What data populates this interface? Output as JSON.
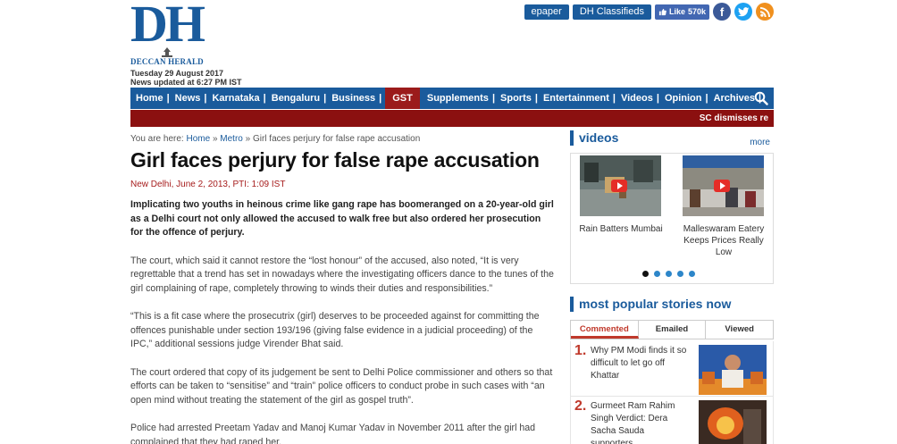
{
  "header": {
    "logo_text": "DH",
    "logo_sub": "DECCAN HERALD",
    "date": "Tuesday 29 August 2017",
    "updated": "News updated at 6:27 PM IST",
    "buttons": [
      "epaper",
      "DH Classifieds"
    ],
    "like_label": "Like",
    "like_count": "570k"
  },
  "nav": {
    "items": [
      "Home",
      "News",
      "Karnataka",
      "Bengaluru",
      "Business",
      "GST",
      "Supplements",
      "Sports",
      "Entertainment",
      "Videos",
      "Opinion",
      "Archives"
    ],
    "ticker": "SC dismisses re"
  },
  "article": {
    "crumb_prefix": "You are here:",
    "crumbs": [
      "Home",
      "Metro",
      "Girl faces perjury for false rape accusation"
    ],
    "crumb_sep": "»",
    "headline": "Girl faces perjury for false rape accusation",
    "dateline": "New Delhi, June 2, 2013, PTI: 1:09 IST",
    "lead": "Implicating two youths in heinous crime like gang rape has boomeranged on a 20-year-old girl as a Delhi court not only allowed the accused to walk free but also ordered her prosecution for the offence of perjury.",
    "paragraphs": [
      "The court, which said it cannot restore the “lost honour” of the accused, also noted, “It is very regrettable that a trend has set in nowadays where the investigating officers dance to the tunes of the girl complaining of rape, completely throwing to winds their duties and responsibilities.”",
      "“This is a fit case where the prosecutrix (girl) deserves to be proceeded against for committing the offences punishable under section 193/196 (giving false evidence in a judicial proceeding) of the IPC,” additional sessions judge Virender Bhat said.",
      "The court ordered that copy of its judgement be sent to Delhi Police commissioner and others so that efforts can be taken to “sensitise” and “train” police officers to conduct probe in such cases with “an open mind without treating the statement of the girl as gospel truth”.",
      "Police had arrested Preetam Yadav and Manoj Kumar Yadav in November 2011 after the girl had complained that they had raped her."
    ]
  },
  "sidebar": {
    "videos_title": "videos",
    "more": "more",
    "videos": [
      {
        "caption": "Rain Batters Mumbai"
      },
      {
        "caption": "Malleswaram Eatery Keeps Prices Really Low"
      }
    ],
    "popular_title": "most popular stories now",
    "tabs": [
      "Commented",
      "Emailed",
      "Viewed"
    ],
    "stories": [
      {
        "num": "1.",
        "title": "Why PM Modi finds it so difficult to let go off Khattar"
      },
      {
        "num": "2.",
        "title": "Gurmeet Ram Rahim Singh Verdict: Dera Sacha Sauda supporters..."
      }
    ]
  },
  "colors": {
    "brand_blue": "#1a5b9c",
    "ticker_red": "#8b1010",
    "accent_red": "#c0392b"
  }
}
